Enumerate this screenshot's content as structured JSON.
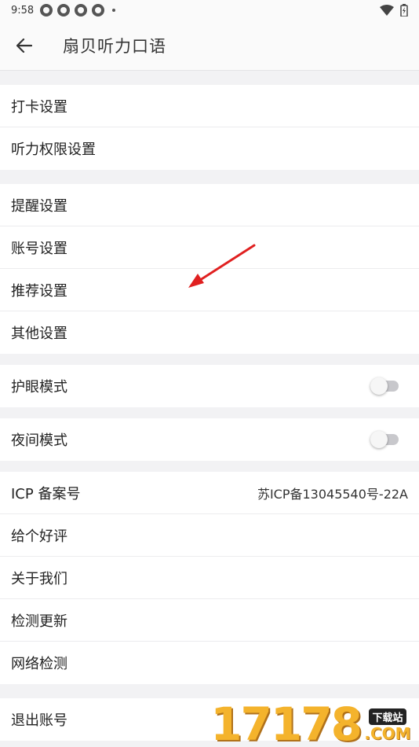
{
  "status_bar": {
    "time": "9:58"
  },
  "app_bar": {
    "title": "扇贝听力口语"
  },
  "groups": [
    {
      "items": [
        {
          "label": "打卡设置"
        },
        {
          "label": "听力权限设置"
        }
      ]
    },
    {
      "items": [
        {
          "label": "提醒设置"
        },
        {
          "label": "账号设置"
        },
        {
          "label": "推荐设置"
        },
        {
          "label": "其他设置"
        }
      ]
    },
    {
      "items": [
        {
          "label": "护眼模式",
          "toggle": false
        }
      ]
    },
    {
      "items": [
        {
          "label": "夜间模式",
          "toggle": false
        }
      ]
    },
    {
      "items": [
        {
          "label": "ICP 备案号",
          "value": "苏ICP备13045540号-22A"
        },
        {
          "label": "给个好评"
        },
        {
          "label": "关于我们"
        },
        {
          "label": "检测更新"
        },
        {
          "label": "网络检测"
        }
      ]
    },
    {
      "items": [
        {
          "label": "退出账号"
        }
      ]
    }
  ],
  "watermark": {
    "text": "17178",
    "tag": "下载站",
    "suffix": ".COM"
  },
  "colors": {
    "arrow": "#e02020",
    "watermark": "#f4b32c"
  }
}
